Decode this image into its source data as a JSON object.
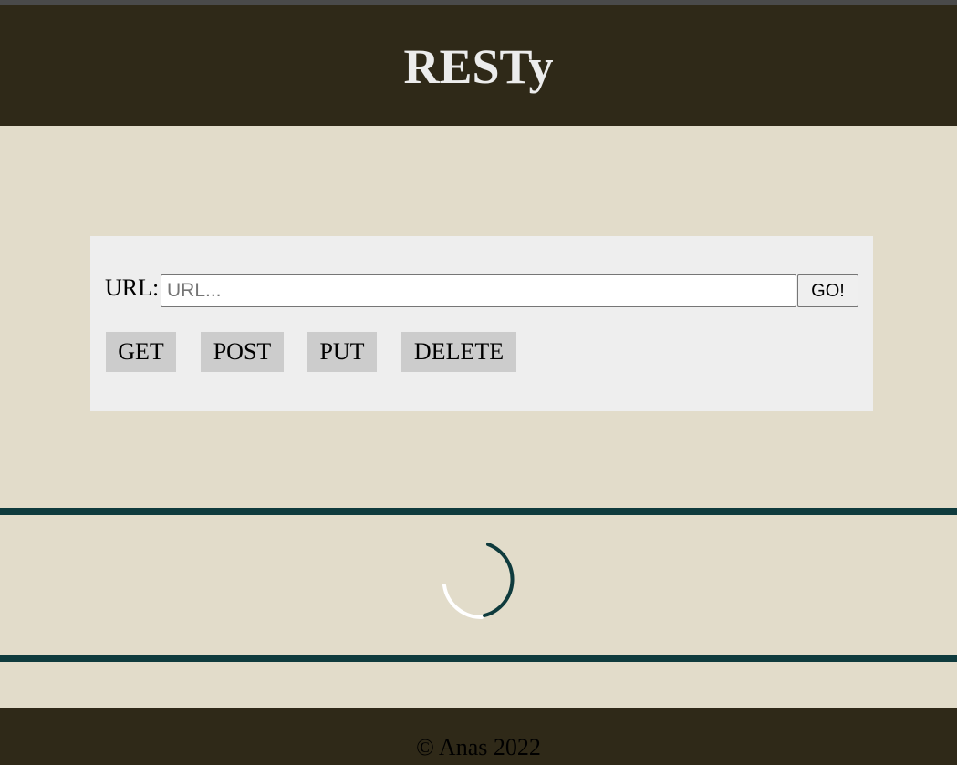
{
  "header": {
    "title": "RESTy"
  },
  "form": {
    "url_label": "URL:",
    "url_value": "",
    "url_placeholder": "URL...",
    "go_label": "GO!",
    "methods": [
      "GET",
      "POST",
      "PUT",
      "DELETE"
    ]
  },
  "loading": {
    "icon": "loading-spinner-icon",
    "accent": "#0f3b3d"
  },
  "footer": {
    "text": "© Anas 2022"
  },
  "colors": {
    "header_bg": "#2f2918",
    "page_bg": "#e2dcca",
    "card_bg": "#eeeeee",
    "method_bg": "#cccccc",
    "rule": "#0f3b3d"
  }
}
